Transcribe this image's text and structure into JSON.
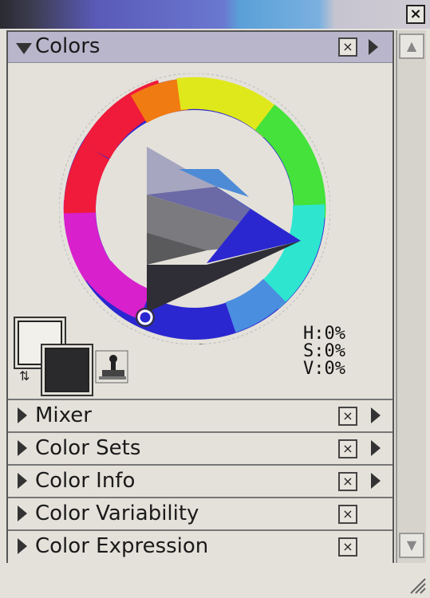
{
  "window": {
    "close_glyph": "×"
  },
  "colors_panel": {
    "title": "Colors",
    "header_close_glyph": "×",
    "hsv": {
      "h": "H:0%",
      "s": "S:0%",
      "v": "V:0%"
    },
    "current_hue_color": "#2b27d0",
    "wheel_colors": [
      "#f01a3a",
      "#f07b12",
      "#dfe81b",
      "#44e23a",
      "#2ee6d0",
      "#4a8ee0",
      "#2b27d0",
      "#d820cc"
    ]
  },
  "sections": [
    {
      "label": "Mixer",
      "has_close": true,
      "has_arrow": true
    },
    {
      "label": "Color Sets",
      "has_close": true,
      "has_arrow": true
    },
    {
      "label": "Color Info",
      "has_close": true,
      "has_arrow": true
    },
    {
      "label": "Color Variability",
      "has_close": true,
      "has_arrow": false
    },
    {
      "label": "Color Expression",
      "has_close": true,
      "has_arrow": false
    }
  ],
  "scrollbar": {
    "up_glyph": "▲",
    "down_glyph": "▼"
  }
}
